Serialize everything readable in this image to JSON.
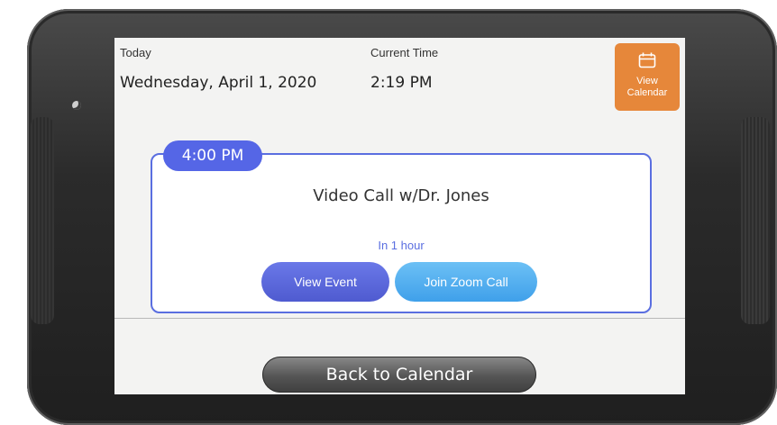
{
  "header": {
    "today_label": "Today",
    "date_value": "Wednesday, April 1, 2020",
    "time_label": "Current Time",
    "time_value": "2:19 PM",
    "view_calendar_line1": "View",
    "view_calendar_line2": "Calendar"
  },
  "event": {
    "time": "4:00 PM",
    "title": "Video Call w/Dr. Jones",
    "relative": "In 1 hour",
    "view_event_label": "View Event",
    "join_label": "Join Zoom Call"
  },
  "footer": {
    "back_label": "Back to Calendar"
  },
  "colors": {
    "accent_orange": "#e6873a",
    "accent_blue": "#5566e6",
    "zoom_blue": "#3fa0ea"
  },
  "icons": {
    "calendar": "calendar-icon",
    "camera": "camera-icon"
  }
}
